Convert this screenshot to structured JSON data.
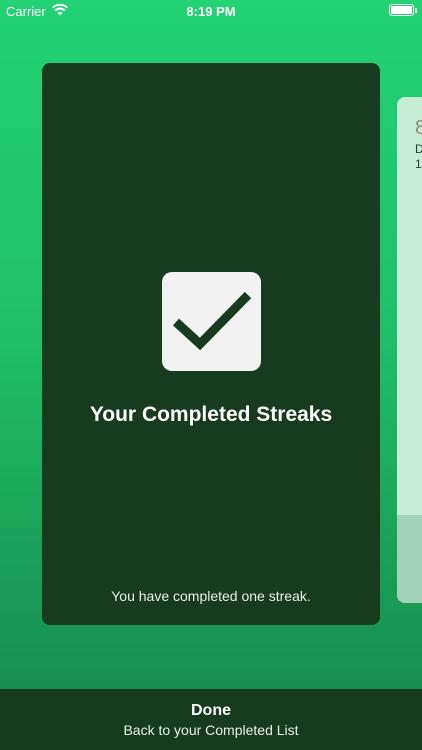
{
  "status_bar": {
    "carrier": "Carrier",
    "time": "8:19 PM",
    "icons": [
      "wifi-icon",
      "battery-icon"
    ]
  },
  "card": {
    "icon": "checkmark-icon",
    "title": "Your Completed Streaks",
    "subtitle": "You have completed one streak."
  },
  "next_card": {
    "number_fragment": "8",
    "line1_fragment": "D",
    "line2_fragment": "1("
  },
  "bottom_bar": {
    "title": "Done",
    "subtitle": "Back to your Completed List"
  },
  "colors": {
    "background_top": "#22d273",
    "background_bottom": "#168a4a",
    "card_dark_green": "#173b1f",
    "checkbox_bg": "#f2f2f2",
    "next_card_light_green": "#c6eed7"
  }
}
